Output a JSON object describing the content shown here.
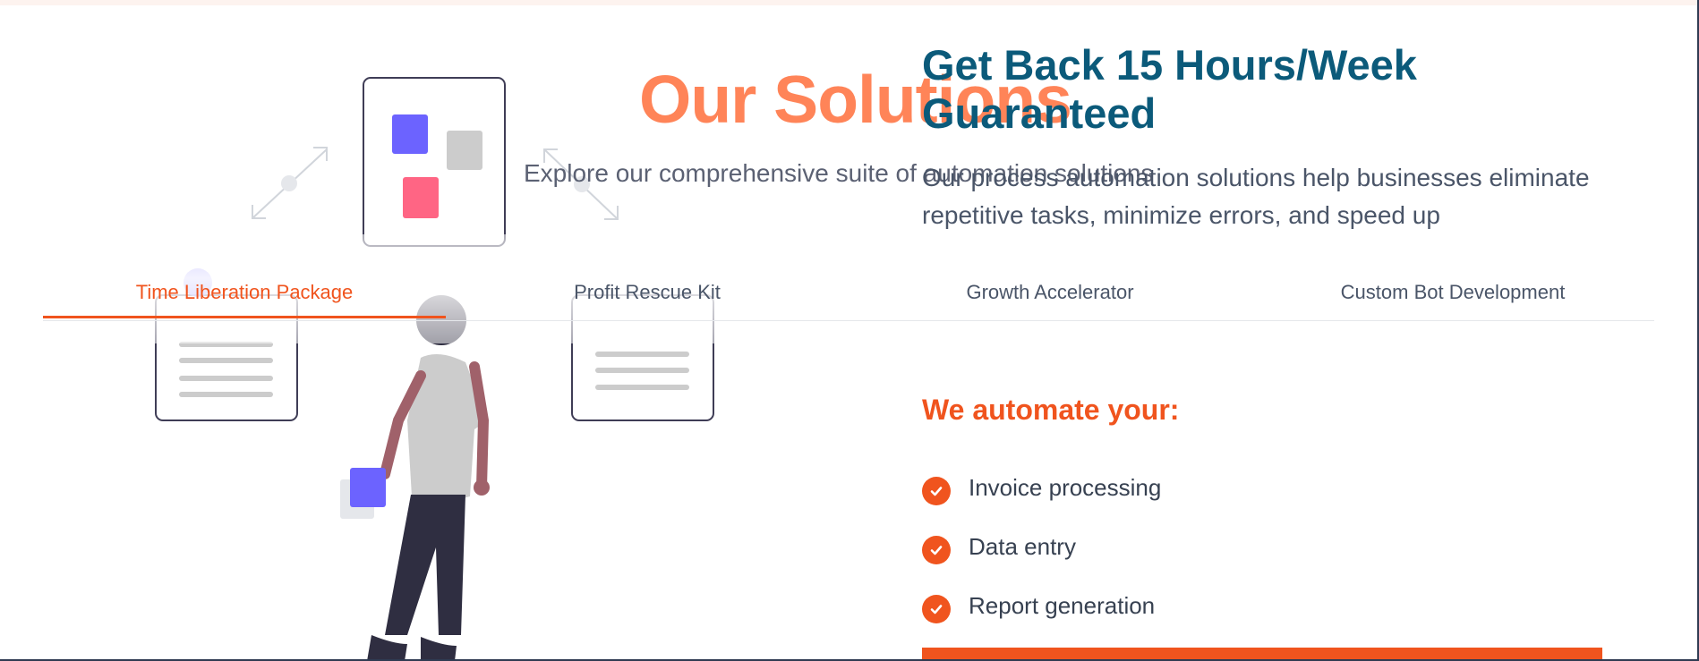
{
  "section": {
    "title": "Our Solutions",
    "subtitle": "Explore our comprehensive suite of automation solutions"
  },
  "hero": {
    "title": "Get Back 15 Hours/Week Guaranteed",
    "description": "Our process automation solutions help businesses eliminate repetitive tasks, minimize errors, and speed up"
  },
  "tabs": [
    {
      "label": "Time Liberation Package",
      "active": true
    },
    {
      "label": "Profit Rescue Kit",
      "active": false
    },
    {
      "label": "Growth Accelerator",
      "active": false
    },
    {
      "label": "Custom Bot Development",
      "active": false
    }
  ],
  "automate": {
    "heading": "We automate your:",
    "items": [
      "Invoice processing",
      "Data entry",
      "Report generation"
    ]
  },
  "colors": {
    "accent": "#f0541e",
    "title_orange": "#ff6f3c",
    "hero_blue": "#0b5a7a",
    "illustration_purple": "#6c63ff",
    "illustration_pink": "#ff6584"
  },
  "icons": [
    "check-circle-icon",
    "expand-arrow-icon"
  ]
}
